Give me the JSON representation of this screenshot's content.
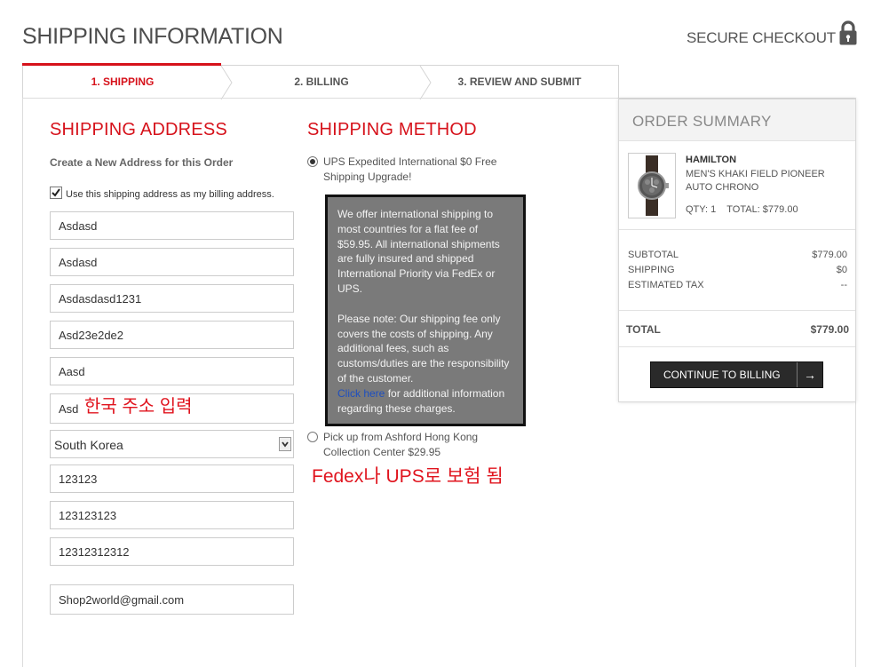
{
  "header": {
    "title": "SHIPPING INFORMATION",
    "secure_label": "SECURE CHECKOUT"
  },
  "tabs": [
    {
      "label": "1. SHIPPING",
      "active": true
    },
    {
      "label": "2. BILLING",
      "active": false
    },
    {
      "label": "3. REVIEW AND SUBMIT",
      "active": false
    }
  ],
  "shipping_address": {
    "title": "SHIPPING ADDRESS",
    "create_label": "Create a New Address for this Order",
    "use_as_billing_label": "Use this shipping address as my billing address.",
    "use_as_billing_checked": true,
    "fields": [
      "Asdasd",
      "Asdasd",
      "Asdasdasd1231",
      "Asd23e2de2",
      "Aasd",
      "Asd"
    ],
    "country": "South Korea",
    "fields2": [
      "123123",
      "123123123",
      "12312312312"
    ],
    "email": "Shop2world@gmail.com"
  },
  "shipping_method": {
    "title": "SHIPPING METHOD",
    "option1": "UPS Expedited International $0 Free Shipping Upgrade!",
    "option1_selected": true,
    "info_p1": "We offer international shipping to most countries for a flat fee of $59.95. All international shipments are fully insured and shipped International Priority via FedEx or UPS.",
    "info_p2_pre": "Please note: Our shipping fee only covers the costs of shipping. Any additional fees, such as customs/duties are the responsibility of the customer.",
    "info_link": "Click here",
    "info_p2_post": "for additional information regarding these charges.",
    "option2": "Pick up from Ashford Hong Kong Collection Center $29.95",
    "option2_selected": false
  },
  "annotations": {
    "korean_address": "한국 주소 입력",
    "fedex_ups": "Fedex나 UPS로 보험 됨"
  },
  "order_summary": {
    "title": "ORDER SUMMARY",
    "brand": "HAMILTON",
    "product": "MEN'S KHAKI FIELD PIONEER AUTO CHRONO",
    "qty_line": "QTY: 1    TOTAL: $779.00",
    "subtotal_label": "SUBTOTAL",
    "subtotal_value": "$779.00",
    "shipping_label": "SHIPPING",
    "shipping_value": "$0",
    "tax_label": "ESTIMATED TAX",
    "tax_value": "--",
    "total_label": "TOTAL",
    "total_value": "$779.00",
    "continue_label": "CONTINUE TO BILLING",
    "continue_arrow": "→"
  },
  "colors": {
    "accent": "#d6121b",
    "info_box_bg": "#7a7a7a",
    "button_bg": "#2a2a2a"
  },
  "icons": [
    "lock-icon",
    "check-icon",
    "chevron-down-icon",
    "arrow-right-icon",
    "watch-image"
  ]
}
